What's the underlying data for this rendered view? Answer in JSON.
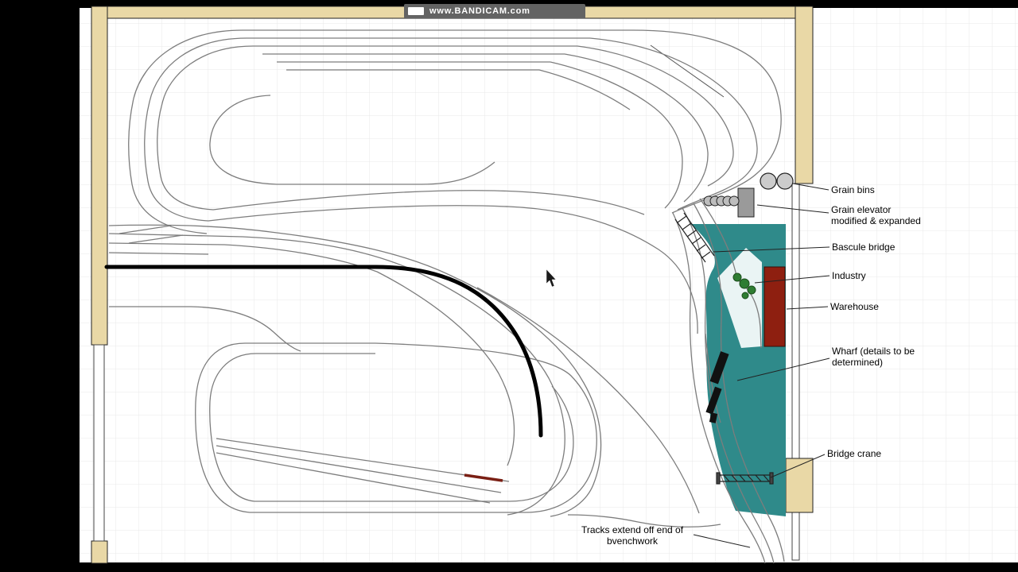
{
  "watermark": {
    "text": "www.BANDICAM.com"
  },
  "colors": {
    "benchwork": "#e9d8a6",
    "water": "#2f8a8a",
    "warehouse": "#8e1f10",
    "track": "#7d7d7d",
    "mainline": "#000000",
    "red_track": "#7a1f14",
    "tree": "#2e7d32",
    "structure_gray": "#9a9a9a"
  },
  "labels": {
    "grain_bins": "Grain bins",
    "grain_elevator": "Grain elevator\nmodified & expanded",
    "bascule_bridge": "Bascule bridge",
    "industry": "Industry",
    "warehouse": "Warehouse",
    "wharf": "Wharf (details to be\ndetermined)",
    "bridge_crane": "Bridge crane",
    "tracks_note": "Tracks extend off end of\nbvenchwork"
  }
}
